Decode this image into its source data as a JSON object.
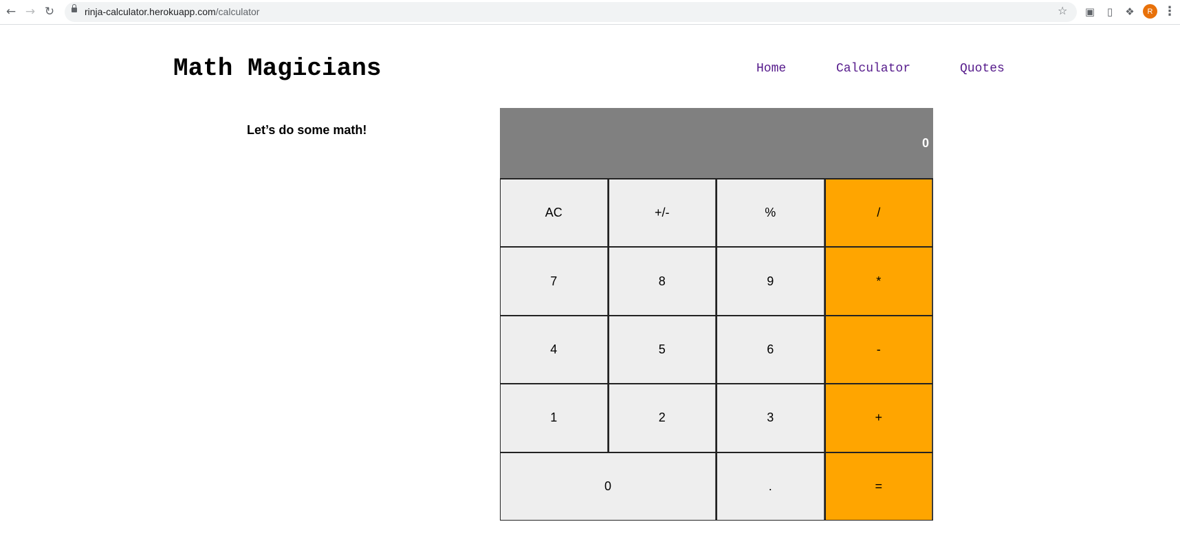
{
  "browser": {
    "url_host": "rinja-calculator.herokuapp.com",
    "url_path": "/calculator",
    "profile_initial": "R"
  },
  "site": {
    "brand": "Math Magicians",
    "nav": [
      "Home",
      "Calculator",
      "Quotes"
    ],
    "intro": "Let’s do some math!"
  },
  "calculator": {
    "display": "0",
    "keys": {
      "ac": "AC",
      "sign": "+/-",
      "percent": "%",
      "divide": "/",
      "seven": "7",
      "eight": "8",
      "nine": "9",
      "multiply": "*",
      "four": "4",
      "five": "5",
      "six": "6",
      "minus": "-",
      "one": "1",
      "two": "2",
      "three": "3",
      "plus": "+",
      "zero": "0",
      "dot": ".",
      "equals": "="
    },
    "colors": {
      "display_bg": "#808080",
      "key_bg": "#eeeeee",
      "operator_bg": "#ffa500"
    }
  },
  "icons": [
    "back-arrow-icon",
    "forward-arrow-icon",
    "reload-icon",
    "lock-icon",
    "star-icon",
    "screenshot-icon",
    "extension-icon",
    "puzzle-icon",
    "menu-icon"
  ]
}
